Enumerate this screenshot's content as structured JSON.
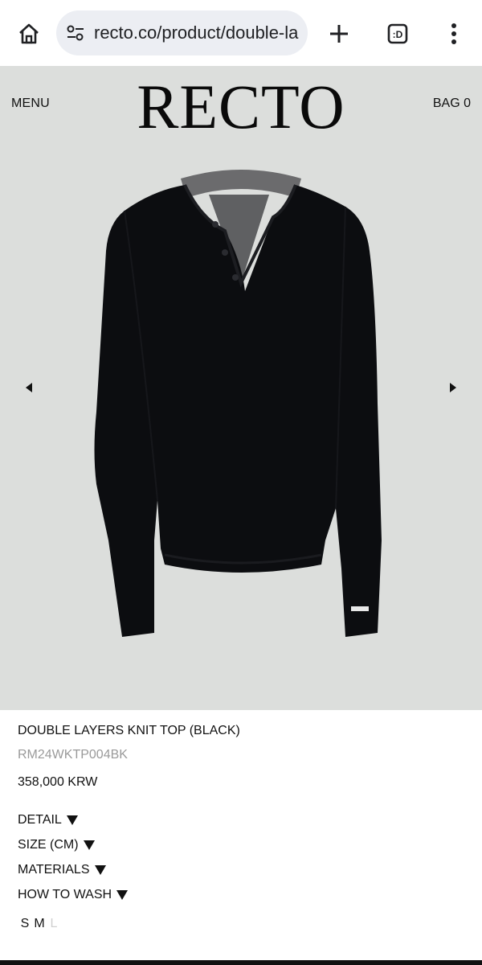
{
  "browser": {
    "url": "recto.co/product/double-la",
    "icons": [
      "home-icon",
      "site-settings-icon",
      "plus-icon",
      "tab-switcher-icon",
      "more-vert-icon"
    ],
    "tab_count_glyph": ":D"
  },
  "site": {
    "menu_label": "MENU",
    "logo": "RECTO",
    "bag_label": "BAG 0"
  },
  "product": {
    "name": "DOUBLE LAYERS KNIT TOP (BLACK)",
    "sku": "RM24WKTP004BK",
    "price": "358,000 KRW",
    "sections": [
      {
        "label": "DETAIL"
      },
      {
        "label": "SIZE (CM)"
      },
      {
        "label": "MATERIALS"
      },
      {
        "label": "HOW TO WASH"
      }
    ],
    "sizes": [
      {
        "label": "S",
        "available": true
      },
      {
        "label": "M",
        "available": true
      },
      {
        "label": "L",
        "available": false
      }
    ]
  },
  "colors": {
    "hero_bg": "#dcdedc",
    "garment": "#0c0d10",
    "undershirt": "#6b6b6d",
    "sku_gray": "#9a9a9a",
    "disabled_size": "#cfcfcf"
  }
}
